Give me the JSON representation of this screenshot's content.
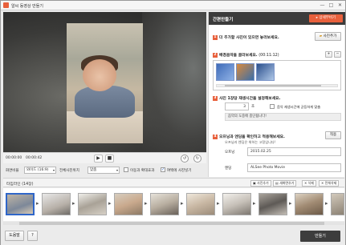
{
  "window": {
    "title": "알씨 동영상 만들기",
    "controls": [
      "—",
      "□",
      "✕"
    ]
  },
  "player": {
    "time_current": "00:00:00",
    "time_total": "00:00:42",
    "play_icon": "play-icon",
    "stop_icon": "stop-icon",
    "rotate_left_icon": "rotate-left-icon",
    "rotate_right_icon": "rotate-right-icon"
  },
  "options": {
    "ratio_label": "화면비율",
    "ratio_value": "와이드 (16:9)",
    "placement_label": "전체사진위치",
    "placement_value": "맞춤",
    "zoom_label": "이동과 확대효과",
    "zoom_checked": false,
    "fill_label": "여백에 사진넣기",
    "fill_checked": true
  },
  "panel": {
    "title": "간편만들기",
    "help_button": "상세무비기",
    "step1": {
      "num": "1",
      "text": "더 추가할 사진이 있으면 놓러보세요.",
      "button": "사진추가"
    },
    "step2": {
      "num": "2",
      "text": "배경음악을 골라보세요.",
      "duration": "(00:11:12)",
      "add": "+",
      "remove": "−"
    },
    "step3": {
      "num": "3",
      "text": "사진 1장당 재생시간을 설정해보세요.",
      "seconds": "3",
      "unit": "초",
      "fit_label": "음악 재생시간에 균등하게 맞춤",
      "note": "음악의 도중에 중단됩니다!"
    },
    "step4": {
      "num": "4",
      "text": "오프닝과 엔딩을 확인하고 적용해보세요.",
      "subtext": "오프닝과 엔딩은 위하는 고정입니다!",
      "apply": "적용",
      "opening_label": "오프닝",
      "opening_value": "2015.02.25",
      "ending_label": "엔딩",
      "ending_value": "ALSee Photo Movie"
    }
  },
  "timeline": {
    "title": "타임라인",
    "count": "(14장)",
    "btn_add": "사진추가",
    "btn_folder": "새화면추가",
    "btn_delete": "삭제",
    "btn_all_delete": "전체삭제"
  },
  "footer": {
    "help": "도움말",
    "question": "?",
    "make": "만들기"
  },
  "colors": {
    "accent": "#e8603c",
    "dark": "#3b3b3b",
    "selected": "#2f66c9"
  }
}
